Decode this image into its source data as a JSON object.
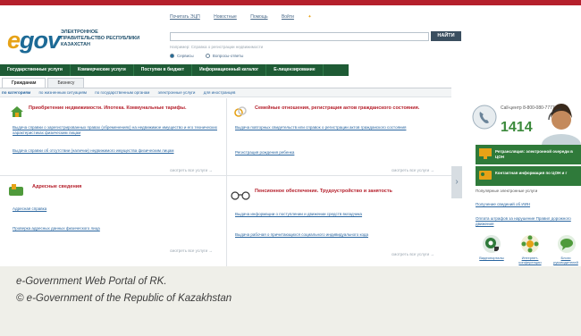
{
  "header": {
    "logo_e": "e",
    "logo_rest": "gov",
    "logo_subtitle": "ЭЛЕКТРОННОЕ ПРАВИТЕЛЬСТВО РЕСПУБЛИКИ КАЗАХСТАН",
    "top_links": [
      "Почитать ЭЦП",
      "Новостные",
      "Помощь",
      "Войти"
    ],
    "search_button": "НАЙТИ",
    "search_hint": "Например: Справка о регистрации недвижимости",
    "radio_options": [
      "Сервисы",
      "Вопросы-ответы"
    ]
  },
  "mainnav": {
    "items": [
      "Государственные услуги",
      "Коммерческие услуги",
      "Поступки в бюджет",
      "Информационный каталог",
      "Е-лицензирование"
    ]
  },
  "tabs": [
    "Гражданам",
    "Бизнесу"
  ],
  "catbar": {
    "items": [
      "по категориям",
      "по жизненным ситуациям",
      "по государственным органам",
      "электронные услуги",
      "для иностранцев"
    ]
  },
  "cards": {
    "realty": {
      "title": "Приобретение недвижимости. Ипотека. Коммунальные тарифы.",
      "links": [
        "Выдача справки о зарегистрированных правах (обременениях) на недвижимое имущество и его технических характеристиках физическим лицам",
        "Выдача справки об отсутствии (наличии) недвижимого имущества физическим лицам"
      ],
      "more": "смотреть все услуги →"
    },
    "family": {
      "title": "Семейные отношения, регистрация актов гражданского состояния.",
      "links": [
        "Выдача повторных свидетельств или справок о регистрации актов гражданского состояния",
        "Регистрация рождения ребенка"
      ],
      "more": "смотреть все услуги →"
    },
    "address": {
      "title": "Адресные сведения",
      "links": [
        "Адресная справка",
        "Проверка адресных данных физического лица"
      ],
      "more": "смотреть все услуги →"
    },
    "pension": {
      "title": "Пенсионное обеспечение. Трудоустройство и занятость",
      "links": [
        "Выдача информации о поступлении и движении средств вкладчика",
        "Выдача рабочая о причитающихся социального индивидуального кода"
      ],
      "more": "смотреть все услуги →"
    }
  },
  "sidebar": {
    "callcenter_label": "Call-центр 8-800-080-7777",
    "callcenter_number": "1414",
    "green_bars": [
      "Ретрансляция: электронной очереди в ЦОН",
      "Контактная информация по ЦОН и г"
    ],
    "popular_label": "Популярные электронные услуги",
    "popular_links": [
      "Получение сведений об ИИН",
      "Оплата штрафов за нарушение Правил дорожного движения"
    ],
    "bottom_items": [
      "Видеопорталы",
      "Интернет-конференции",
      "Блоги руководителей"
    ]
  },
  "caption": {
    "line1": "e-Government Web Portal of RK.",
    "line2": "© e-Government of the Republic of Kazakhstan"
  },
  "colors": {
    "top_bar": "#b5202c",
    "nav_green": "#1e5b35",
    "logo_blue": "#1d6a96",
    "logo_orange": "#e6a217",
    "card_red": "#b5202c",
    "link_blue": "#2a66a0"
  }
}
